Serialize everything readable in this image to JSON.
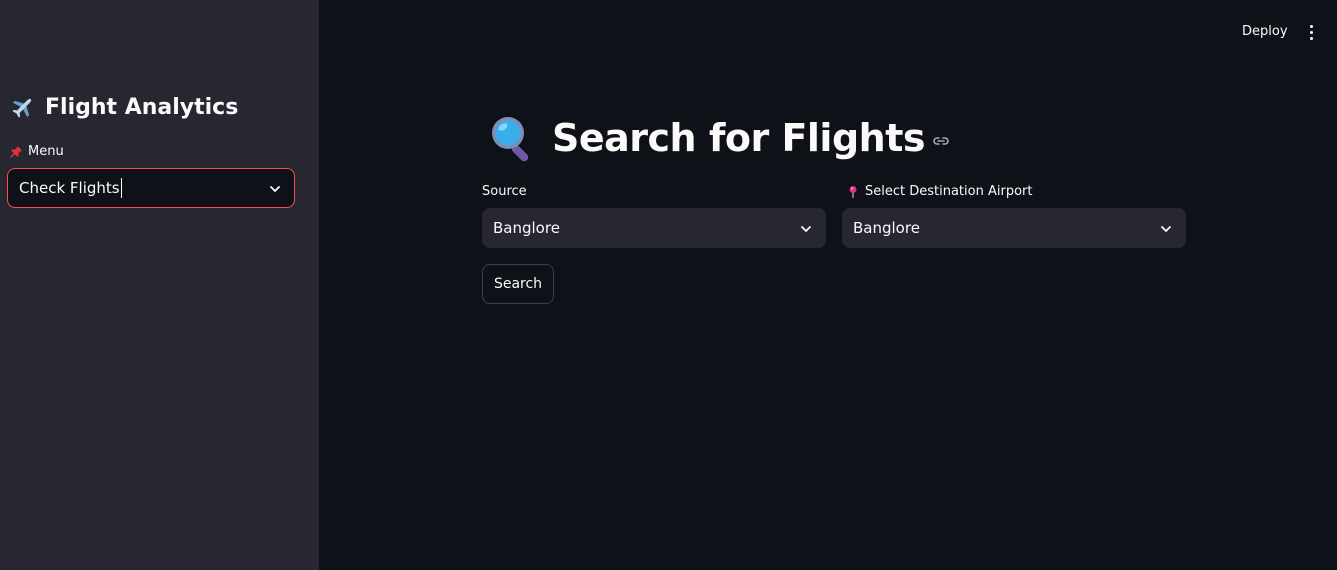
{
  "sidebar": {
    "title": "Flight Analytics",
    "title_icon": "airplane-icon",
    "menu_label": "Menu",
    "menu_icon": "pushpin-icon",
    "menu_value": "Check Flights"
  },
  "header": {
    "deploy_label": "Deploy",
    "menu_icon": "kebab-menu-icon"
  },
  "main": {
    "title": "Search for Flights",
    "title_icon": "magnifying-glass-icon",
    "source": {
      "label": "Source",
      "value": "Banglore"
    },
    "destination": {
      "label": "Select Destination Airport",
      "icon": "round-pushpin-icon",
      "value": "Banglore"
    },
    "search_button": "Search"
  },
  "colors": {
    "background": "#0e1117",
    "sidebar": "#262730",
    "accent": "#ff4b4b",
    "text": "#fafafa"
  }
}
